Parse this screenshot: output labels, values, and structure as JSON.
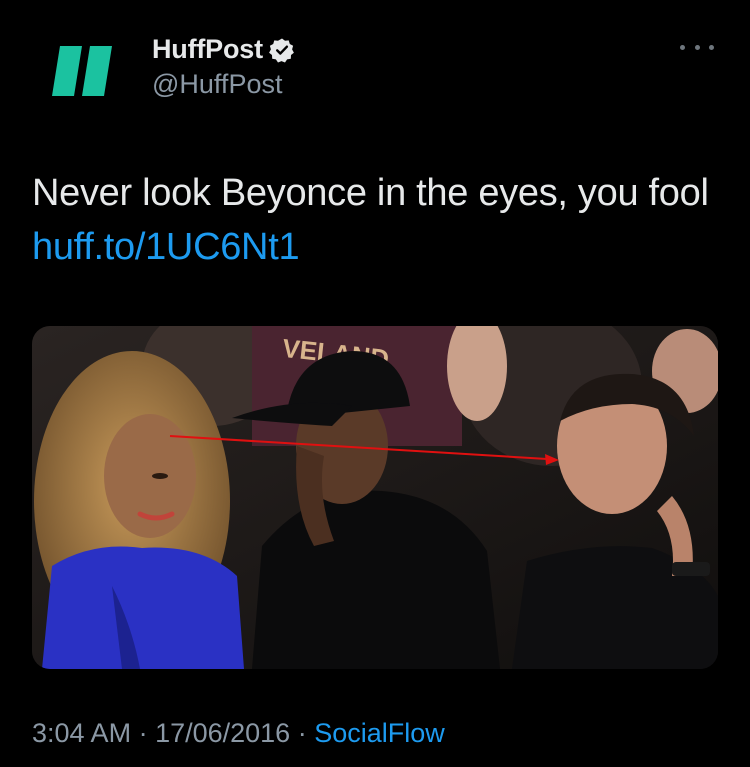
{
  "author": {
    "display_name": "HuffPost",
    "handle": "@HuffPost",
    "verified": true,
    "avatar_icon": "huffpost-logo-icon",
    "brand_color": "#1bc2a0"
  },
  "tweet": {
    "text": "Never look Beyonce in the eyes, you fool ",
    "link_text": "huff.to/1UC6Nt1",
    "link_color": "#1d9bf0"
  },
  "media": {
    "image_text": "VELAND",
    "arrow_color": "#e01010"
  },
  "meta": {
    "time": "3:04 AM",
    "separator": " · ",
    "date": "17/06/2016",
    "source": "SocialFlow"
  },
  "colors": {
    "background": "#000000",
    "primary_text": "#e7e9ea",
    "secondary_text": "#8b98a5",
    "accent": "#1d9bf0"
  }
}
